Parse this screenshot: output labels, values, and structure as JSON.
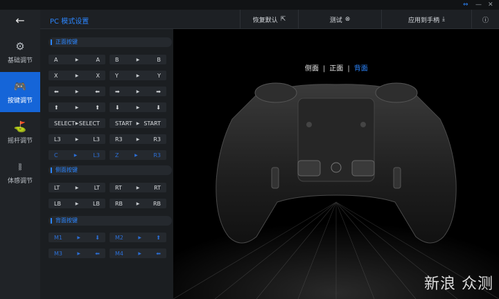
{
  "titlebar": {
    "link_icon": "⇔",
    "minimize": "—",
    "close": "✕"
  },
  "sidebar": {
    "back_icon": "←",
    "items": [
      {
        "label": "基础调节",
        "icon": "⚙"
      },
      {
        "label": "按键调节",
        "icon": "🎮"
      },
      {
        "label": "摇杆调节",
        "icon": "⛳"
      },
      {
        "label": "体感调节",
        "icon": "⧚"
      }
    ],
    "active_index": 1
  },
  "header": {
    "title": "PC 模式设置",
    "restore_label": "恢复默认",
    "restore_icon": "⇱",
    "test_label": "测试",
    "test_icon": "⊗",
    "apply_label": "应用到手柄",
    "apply_icon": "⤓",
    "info_icon": "ⓘ"
  },
  "panel": {
    "sections": [
      "正面按键",
      "侧面按键",
      "背面按键"
    ],
    "front_rows": [
      [
        [
          "A",
          "A"
        ],
        [
          "B",
          "B"
        ]
      ],
      [
        [
          "X",
          "X"
        ],
        [
          "Y",
          "Y"
        ]
      ],
      [
        [
          "⬅",
          "⬅"
        ],
        [
          "➡",
          "➡"
        ]
      ],
      [
        [
          "⬆",
          "⬆"
        ],
        [
          "⬇",
          "⬇"
        ]
      ],
      [
        [
          "SELECT",
          "SELECT"
        ],
        [
          "START",
          "START"
        ]
      ],
      [
        [
          "L3",
          "L3"
        ],
        [
          "R3",
          "R3"
        ]
      ],
      [
        [
          "C",
          "L3"
        ],
        [
          "Z",
          "R3"
        ]
      ]
    ],
    "side_rows": [
      [
        [
          "LT",
          "LT"
        ],
        [
          "RT",
          "RT"
        ]
      ],
      [
        [
          "LB",
          "LB"
        ],
        [
          "RB",
          "RB"
        ]
      ]
    ],
    "back_rows": [
      [
        [
          "M1",
          "⬇"
        ],
        [
          "M2",
          "⬆"
        ]
      ],
      [
        [
          "M3",
          "⬅"
        ],
        [
          "M4",
          "⬅"
        ]
      ]
    ]
  },
  "view": {
    "tabs": [
      "侧面",
      "正面",
      "背面"
    ],
    "active_tab": 2,
    "watermark": "新浪 众测"
  }
}
